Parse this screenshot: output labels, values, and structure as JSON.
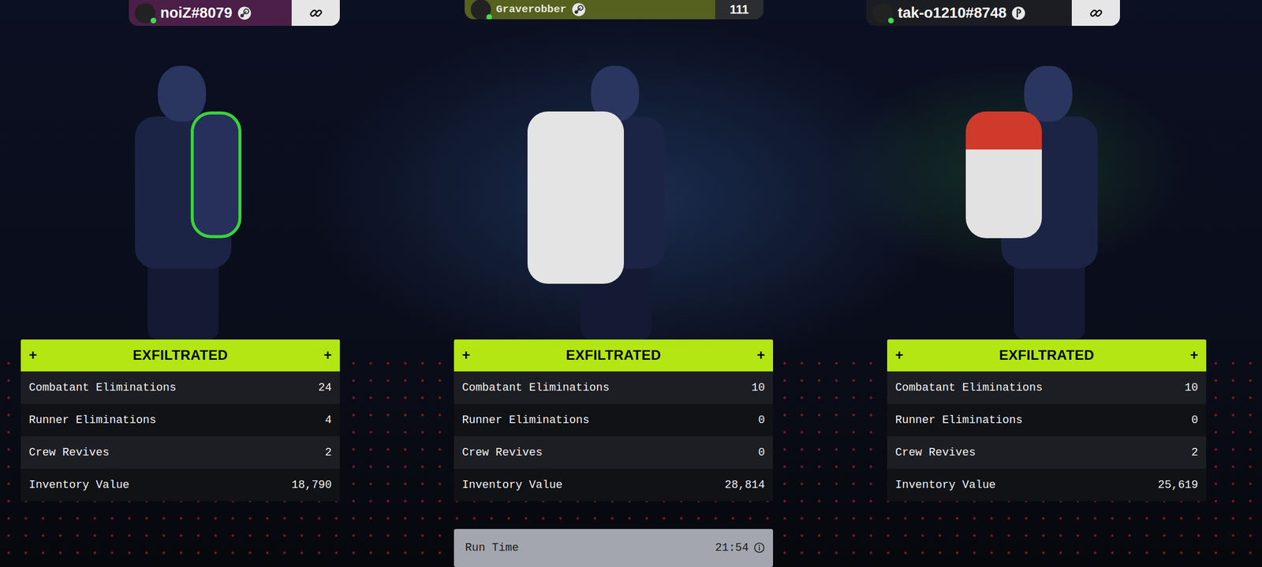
{
  "players": [
    {
      "tag": "noiZ#8079",
      "kind": "steam",
      "online": true,
      "color": "#4b1f48",
      "link_button": true,
      "status": "EXFILTRATED",
      "marks": [
        "+",
        "+"
      ],
      "stats": [
        {
          "label": "Combatant Eliminations",
          "value": "24"
        },
        {
          "label": "Runner Eliminations",
          "value": "4"
        },
        {
          "label": "Crew Revives",
          "value": "2"
        },
        {
          "label": "Inventory Value",
          "value": "18,790"
        }
      ]
    },
    {
      "subtitle": "Graverobber",
      "badge": "111",
      "kind": "steam",
      "online": true,
      "color": "#56601f",
      "link_button": false,
      "status": "EXFILTRATED",
      "marks": [
        "+",
        "+"
      ],
      "stats": [
        {
          "label": "Combatant Eliminations",
          "value": "10"
        },
        {
          "label": "Runner Eliminations",
          "value": "0"
        },
        {
          "label": "Crew Revives",
          "value": "0"
        },
        {
          "label": "Inventory Value",
          "value": "28,814"
        }
      ],
      "run_time": {
        "label": "Run Time",
        "value": "21:54"
      }
    },
    {
      "tag": "tak-o1210#8748",
      "kind": "playstation",
      "online": true,
      "color": "#1c1d22",
      "link_button": true,
      "status": "EXFILTRATED",
      "marks": [
        "+",
        "+"
      ],
      "stats": [
        {
          "label": "Combatant Eliminations",
          "value": "10"
        },
        {
          "label": "Runner Eliminations",
          "value": "0"
        },
        {
          "label": "Crew Revives",
          "value": "2"
        },
        {
          "label": "Inventory Value",
          "value": "25,619"
        }
      ]
    }
  ]
}
